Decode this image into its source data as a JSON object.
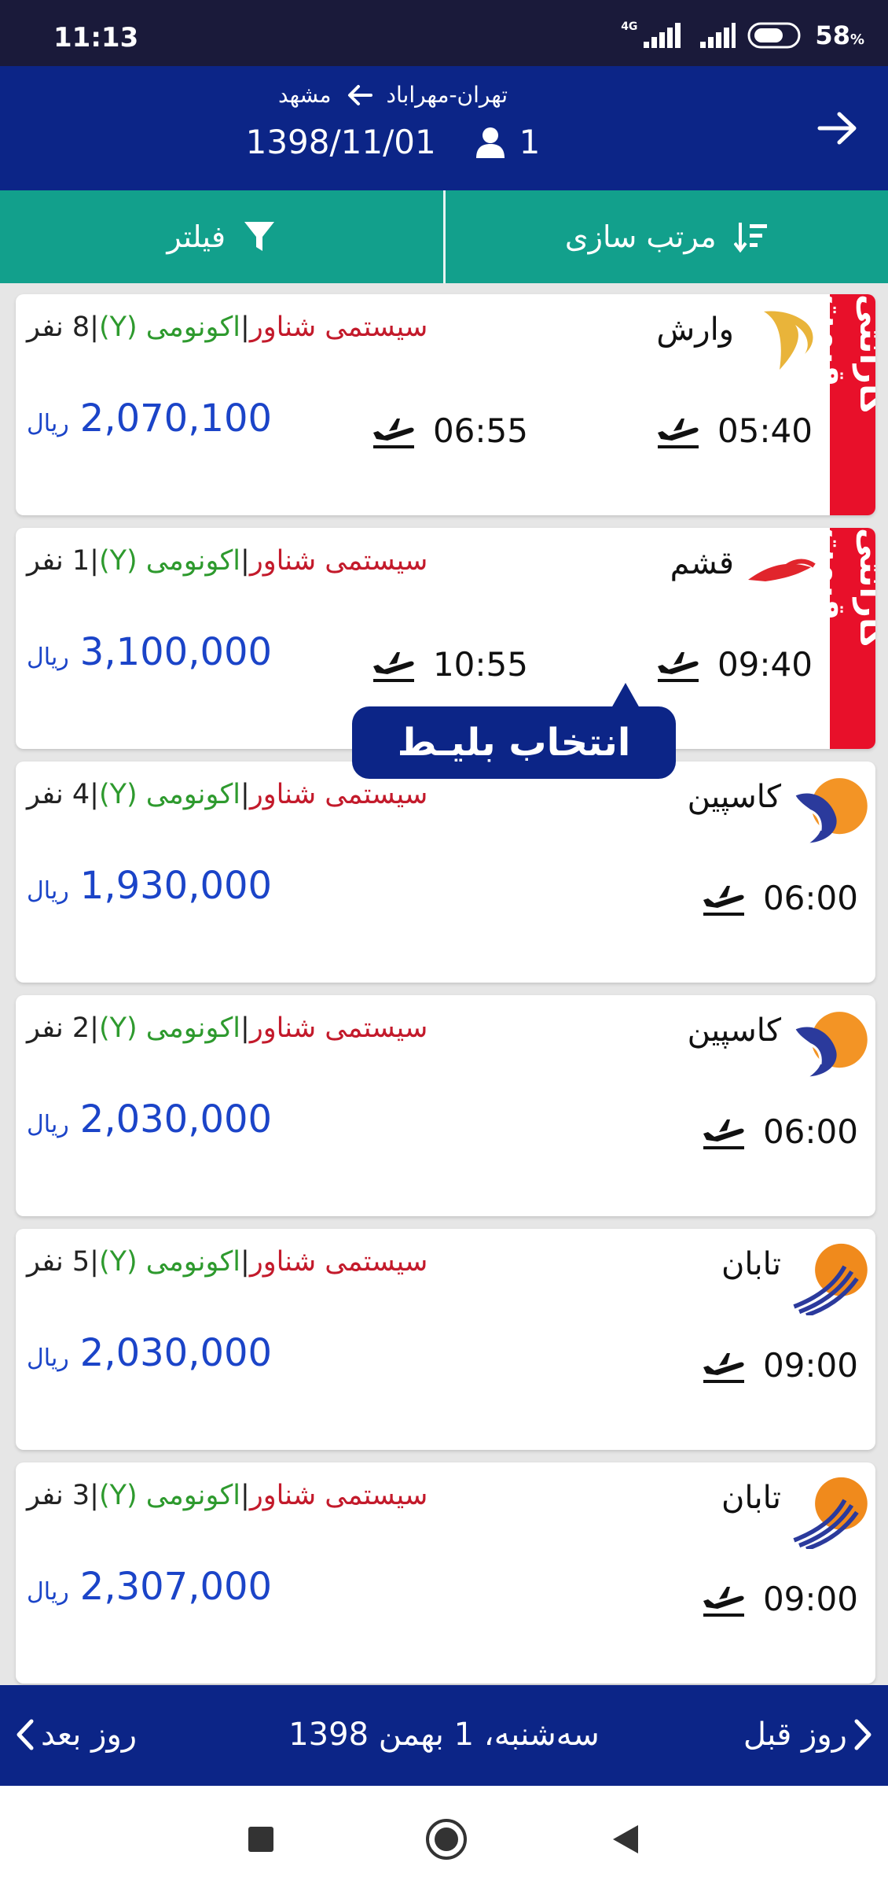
{
  "status_bar": {
    "time": "11:13",
    "network": "4G",
    "battery": "58",
    "battery_unit": "%"
  },
  "header": {
    "route_from": "تهران-مهراباد",
    "route_to": "مشهد",
    "date": "1398/11/01",
    "passengers": "1"
  },
  "actions": {
    "sort_label": "مرتب سازی",
    "filter_label": "فیلتر"
  },
  "badge_text": "گارانتی قیمت",
  "tooltip": "انتخاب بلیـط",
  "flights": [
    {
      "airline": "وارش",
      "fare_system": "سیستمی شناور",
      "fare_class": "اکونومی (Y)",
      "seats": "8 نفر",
      "departure": "05:40",
      "arrival": "06:55",
      "price": "2,070,100",
      "currency": "ریال",
      "guarantee": true,
      "logo": "varesh"
    },
    {
      "airline": "قشم",
      "fare_system": "سیستمی شناور",
      "fare_class": "اکونومی (Y)",
      "seats": "1 نفر",
      "departure": "09:40",
      "arrival": "10:55",
      "price": "3,100,000",
      "currency": "ریال",
      "guarantee": true,
      "logo": "qeshm"
    },
    {
      "airline": "کاسپین",
      "fare_system": "سیستمی شناور",
      "fare_class": "اکونومی (Y)",
      "seats": "4 نفر",
      "departure": "06:00",
      "price": "1,930,000",
      "currency": "ریال",
      "guarantee": false,
      "logo": "caspian"
    },
    {
      "airline": "کاسپین",
      "fare_system": "سیستمی شناور",
      "fare_class": "اکونومی (Y)",
      "seats": "2 نفر",
      "departure": "06:00",
      "price": "2,030,000",
      "currency": "ریال",
      "guarantee": false,
      "logo": "caspian"
    },
    {
      "airline": "تابان",
      "fare_system": "سیستمی شناور",
      "fare_class": "اکونومی (Y)",
      "seats": "5 نفر",
      "departure": "09:00",
      "price": "2,030,000",
      "currency": "ریال",
      "guarantee": false,
      "logo": "taban"
    },
    {
      "airline": "تابان",
      "fare_system": "سیستمی شناور",
      "fare_class": "اکونومی (Y)",
      "seats": "3 نفر",
      "departure": "09:00",
      "price": "2,307,000",
      "currency": "ریال",
      "guarantee": false,
      "logo": "taban"
    }
  ],
  "footer": {
    "prev_label": "روز قبل",
    "next_label": "روز بعد",
    "date_label": "سه‌شنبه، 1 بهمن 1398"
  },
  "colors": {
    "header_blue": "#0c2587",
    "teal": "#12a08c",
    "guarantee_red": "#e8102a",
    "price_blue": "#1b44c8",
    "system_red": "#c31a2b",
    "class_green": "#2e9a2e"
  }
}
